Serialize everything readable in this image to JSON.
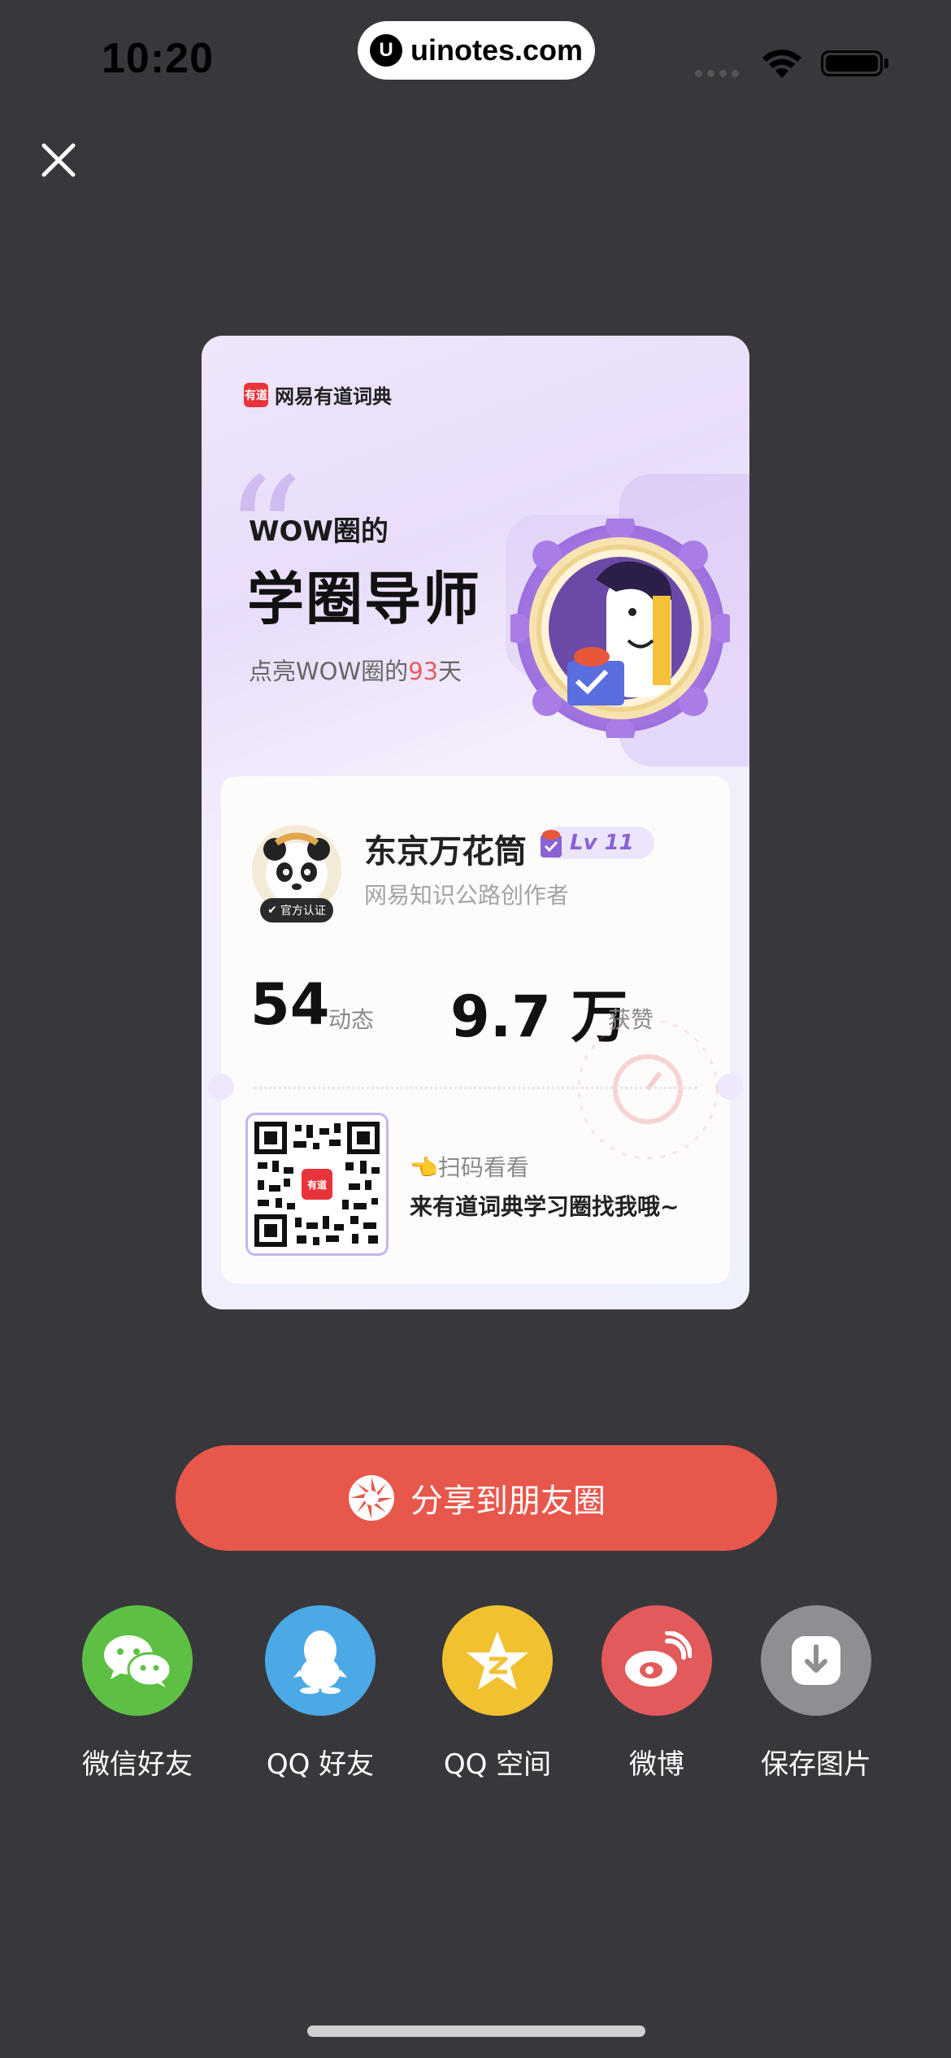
{
  "status_bar": {
    "time": "10:20",
    "site": "uinotes.com",
    "site_logo": "U"
  },
  "card": {
    "brand_logo_text": "有道",
    "brand_name": "网易有道词典",
    "subhead": "WOW圈的",
    "headline": "学圈导师",
    "days_prefix": "点亮WOW圈的",
    "days_value": "93",
    "days_suffix": "天",
    "profile": {
      "name": "东京万花筒",
      "level": "Lv 11",
      "verified_label": "官方认证",
      "role": "网易知识公路创作者"
    },
    "stats": [
      {
        "value": "54",
        "label": "动态"
      },
      {
        "value": "9.7 万",
        "label": "获赞"
      }
    ],
    "qr_logo_text": "有道",
    "scan_hint": "👈扫码看看",
    "scan_desc": "来有道词典学习圈找我哦~"
  },
  "share_moments_label": "分享到朋友圈",
  "share_options": [
    {
      "label": "微信好友",
      "icon": "wechat-icon",
      "color": "#5dc045"
    },
    {
      "label": "QQ 好友",
      "icon": "qq-icon",
      "color": "#4ba9e6"
    },
    {
      "label": "QQ 空间",
      "icon": "qzone-icon",
      "color": "#f2c130"
    },
    {
      "label": "微博",
      "icon": "weibo-icon",
      "color": "#e25a5a"
    },
    {
      "label": "保存图片",
      "icon": "download-icon",
      "color": "#8e8e93"
    }
  ]
}
